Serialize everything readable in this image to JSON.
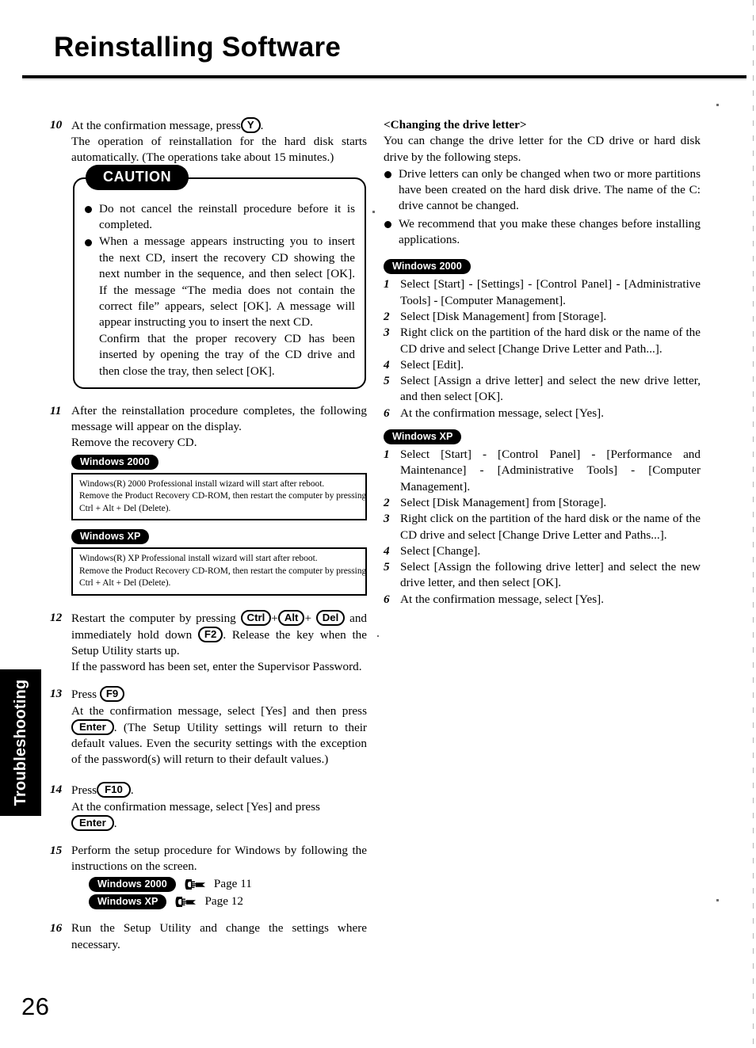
{
  "document": {
    "title": "Reinstalling Software",
    "page_number": "26",
    "side_tab": "Troubleshooting"
  },
  "left_column": {
    "step10": {
      "num": "10",
      "line1_a": "At the confirmation message, press",
      "key_y": "Y",
      "line1_b": ".",
      "body": "The operation of reinstallation for the hard disk starts automatically. (The operations take about 15 minutes.)"
    },
    "caution": {
      "badge": "CAUTION",
      "bullets": [
        "Do not cancel the reinstall procedure before it is completed.",
        "When a message appears instructing you to insert the next CD, insert the recovery CD showing the next number in the sequence, and then select [OK]. If the message “The media does not contain the correct file” appears, select [OK]. A message will appear instructing you to insert the next CD.\nConfirm that the proper recovery CD has been inserted by opening the tray of the CD drive and then close the tray, then select [OK]."
      ],
      "bullet2_part1": "When a message appears instructing you to insert the next CD, insert the recovery CD showing the next number in the sequence, and then select [OK]. If the message “The media does not contain the correct file” appears, select [OK]. A message will appear instructing you to insert the next CD.",
      "bullet2_part2": "Confirm that the proper recovery CD has been inserted by opening the tray of the CD drive and then close the tray, then select [OK]."
    },
    "step11": {
      "num": "11",
      "body": "After the reinstallation procedure completes, the following message will appear on the display.",
      "body2": "Remove the recovery CD.",
      "win2000_pill": "Windows 2000",
      "win2000_msg": [
        "Windows(R) 2000 Professional install wizard will start after reboot.",
        "Remove the Product Recovery CD-ROM, then restart the computer by pressing",
        "Ctrl + Alt + Del (Delete)."
      ],
      "winxp_pill": "Windows XP",
      "winxp_msg": [
        "Windows(R) XP Professional install wizard will start after reboot.",
        "Remove the Product Recovery CD-ROM, then restart the computer by pressing",
        "Ctrl + Alt + Del (Delete)."
      ]
    },
    "step12": {
      "num": "12",
      "a": "Restart the computer by pressing",
      "key_ctrl": "Ctrl",
      "plus1": "+",
      "key_alt": "Alt",
      "plus2": "+",
      "key_del": "Del",
      "b": "and immediately hold down",
      "key_f2": "F2",
      "c": ". Release the key when the Setup Utility starts up.",
      "d": "If the password has been set, enter the Supervisor Password."
    },
    "step13": {
      "num": "13",
      "a": "Press",
      "key_f9": "F9",
      "b": "At the confirmation message, select [Yes] and then press",
      "key_enter": "Enter",
      "c": ". (The Setup Utility settings will return to their default values.  Even the security settings with the exception of the password(s) will return to their default values.)"
    },
    "step14": {
      "num": "14",
      "a": "Press",
      "key_f10": "F10",
      "a2": ".",
      "b": "At the confirmation message, select [Yes] and press",
      "key_enter": "Enter",
      "c": "."
    },
    "step15": {
      "num": "15",
      "body": "Perform the setup procedure for Windows by following the instructions on the screen.",
      "refs": [
        {
          "pill": "Windows 2000",
          "page": "Page 11"
        },
        {
          "pill": "Windows XP",
          "page": "Page 12"
        }
      ]
    },
    "step16": {
      "num": "16",
      "body": "Run the Setup Utility and change the settings where necessary."
    }
  },
  "right_column": {
    "heading": "<Changing the drive letter>",
    "intro": "You can change the drive letter for the CD drive or hard disk drive by the following steps.",
    "bullets": [
      "Drive letters can only be changed when two or more partitions have been created on the hard disk drive. The name of the C: drive cannot be changed.",
      "We recommend that you make these changes before installing applications."
    ],
    "win2000": {
      "pill": "Windows 2000",
      "steps": [
        {
          "num": "1",
          "text": "Select [Start] - [Settings] - [Control Panel] - [Administrative Tools] - [Computer Management]."
        },
        {
          "num": "2",
          "text": "Select [Disk Management] from [Storage]."
        },
        {
          "num": "3",
          "text": "Right click on the partition of the hard disk or the name of the CD drive and select [Change Drive Letter and Path...]."
        },
        {
          "num": "4",
          "text": "Select [Edit]."
        },
        {
          "num": "5",
          "text": "Select [Assign a drive letter] and select the new drive letter, and then select [OK]."
        },
        {
          "num": "6",
          "text": "At the confirmation message, select [Yes]."
        }
      ]
    },
    "winxp": {
      "pill": "Windows XP",
      "steps": [
        {
          "num": "1",
          "text": "Select [Start] - [Control Panel] - [Performance and Maintenance] - [Administrative Tools] - [Computer Management]."
        },
        {
          "num": "2",
          "text": "Select [Disk Management] from [Storage]."
        },
        {
          "num": "3",
          "text": "Right click on the partition of the hard disk or the name of the CD drive and select [Change Drive Letter and Paths...]."
        },
        {
          "num": "4",
          "text": "Select [Change]."
        },
        {
          "num": "5",
          "text": "Select [Assign the following drive letter] and select the new drive letter, and then select [OK]."
        },
        {
          "num": "6",
          "text": "At the confirmation message, select [Yes]."
        }
      ]
    }
  },
  "colors": {
    "ink": "#000000",
    "paper": "#ffffff"
  }
}
